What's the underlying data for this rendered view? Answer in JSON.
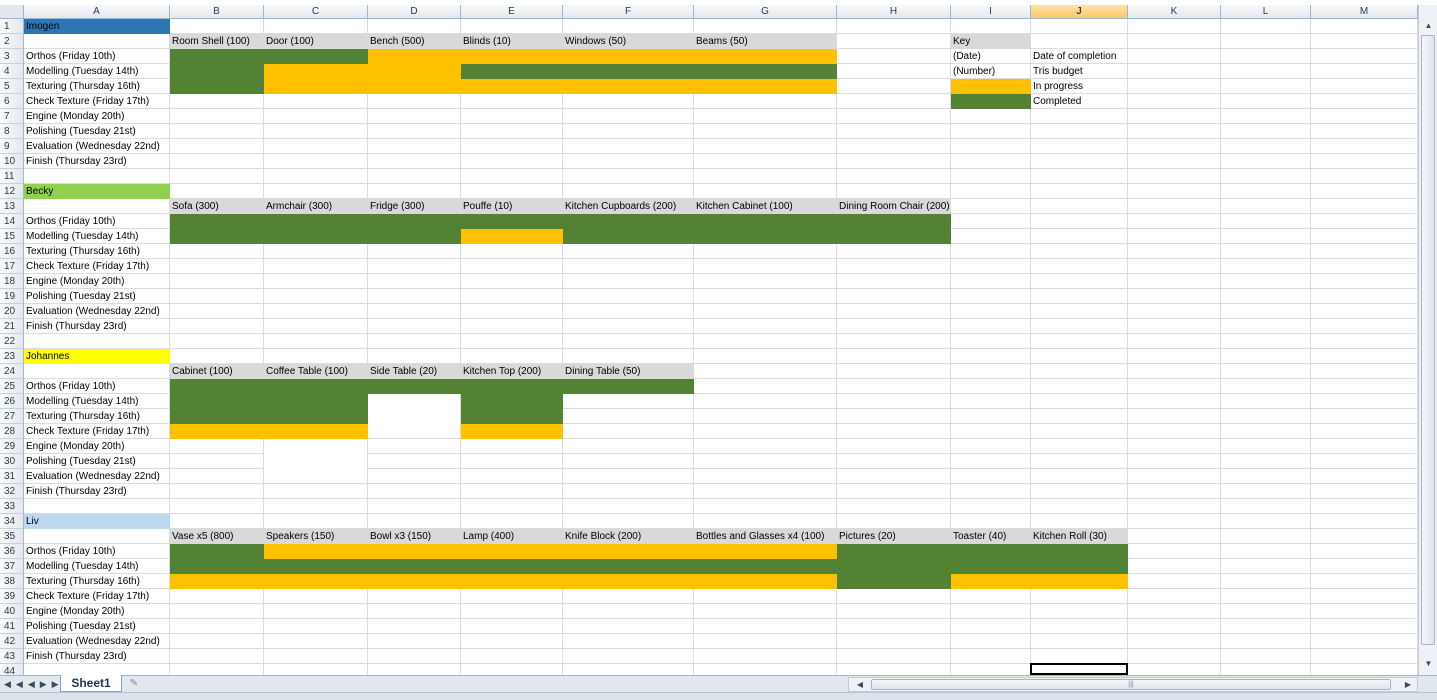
{
  "columns": [
    "A",
    "B",
    "C",
    "D",
    "E",
    "F",
    "G",
    "H",
    "I",
    "J",
    "K",
    "L",
    "M"
  ],
  "selected_column": "J",
  "colors": {
    "in_progress": "#ffc000",
    "completed": "#548235",
    "header_gray": "#d9d9d9",
    "imogen": "#2e75b6",
    "becky": "#92d050",
    "johannes": "#ffff00",
    "liv": "#bdd7ee"
  },
  "cells": [
    {
      "r": 1,
      "c": "A",
      "v": "Imogen",
      "fill": "#2e75b6"
    },
    {
      "r": 2,
      "c": "B",
      "v": "Room Shell (100)"
    },
    {
      "r": 2,
      "c": "C",
      "v": "Door (100)"
    },
    {
      "r": 2,
      "c": "D",
      "v": "Bench (500)"
    },
    {
      "r": 2,
      "c": "E",
      "v": "Blinds (10)"
    },
    {
      "r": 2,
      "c": "F",
      "v": "Windows (50)"
    },
    {
      "r": 2,
      "c": "G",
      "v": "Beams (50)"
    },
    {
      "r": 2,
      "c": "I",
      "v": "Key"
    },
    {
      "r": 3,
      "c": "A",
      "v": "Orthos (Friday 10th)"
    },
    {
      "r": 3,
      "c": "I",
      "v": "(Date)"
    },
    {
      "r": 3,
      "c": "J",
      "v": "Date of completion"
    },
    {
      "r": 4,
      "c": "A",
      "v": "Modelling (Tuesday 14th)"
    },
    {
      "r": 4,
      "c": "I",
      "v": "(Number)"
    },
    {
      "r": 4,
      "c": "J",
      "v": "Tris budget"
    },
    {
      "r": 5,
      "c": "A",
      "v": "Texturing (Thursday 16th)"
    },
    {
      "r": 5,
      "c": "J",
      "v": "In progress"
    },
    {
      "r": 6,
      "c": "A",
      "v": "Check Texture (Friday 17th)"
    },
    {
      "r": 6,
      "c": "J",
      "v": "Completed"
    },
    {
      "r": 7,
      "c": "A",
      "v": "Engine (Monday 20th)"
    },
    {
      "r": 8,
      "c": "A",
      "v": "Polishing (Tuesday 21st)"
    },
    {
      "r": 9,
      "c": "A",
      "v": "Evaluation (Wednesday 22nd)"
    },
    {
      "r": 10,
      "c": "A",
      "v": "Finish (Thursday 23rd)"
    },
    {
      "r": 12,
      "c": "A",
      "v": "Becky"
    },
    {
      "r": 13,
      "c": "B",
      "v": "Sofa (300)"
    },
    {
      "r": 13,
      "c": "C",
      "v": "Armchair (300)"
    },
    {
      "r": 13,
      "c": "D",
      "v": "Fridge (300)"
    },
    {
      "r": 13,
      "c": "E",
      "v": "Pouffe (10)"
    },
    {
      "r": 13,
      "c": "F",
      "v": "Kitchen Cupboards (200)"
    },
    {
      "r": 13,
      "c": "G",
      "v": "Kitchen Cabinet (100)"
    },
    {
      "r": 13,
      "c": "H",
      "v": "Dining Room Chair (200)"
    },
    {
      "r": 14,
      "c": "A",
      "v": "Orthos (Friday 10th)"
    },
    {
      "r": 15,
      "c": "A",
      "v": "Modelling (Tuesday 14th)"
    },
    {
      "r": 16,
      "c": "A",
      "v": "Texturing (Thursday 16th)"
    },
    {
      "r": 17,
      "c": "A",
      "v": "Check Texture (Friday 17th)"
    },
    {
      "r": 18,
      "c": "A",
      "v": "Engine (Monday 20th)"
    },
    {
      "r": 19,
      "c": "A",
      "v": "Polishing (Tuesday 21st)"
    },
    {
      "r": 20,
      "c": "A",
      "v": "Evaluation (Wednesday 22nd)"
    },
    {
      "r": 21,
      "c": "A",
      "v": "Finish (Thursday 23rd)"
    },
    {
      "r": 23,
      "c": "A",
      "v": "Johannes"
    },
    {
      "r": 24,
      "c": "B",
      "v": "Cabinet (100)"
    },
    {
      "r": 24,
      "c": "C",
      "v": "Coffee Table (100)"
    },
    {
      "r": 24,
      "c": "D",
      "v": "Side Table (20)"
    },
    {
      "r": 24,
      "c": "E",
      "v": "Kitchen Top (200)"
    },
    {
      "r": 24,
      "c": "F",
      "v": "Dining Table (50)"
    },
    {
      "r": 25,
      "c": "A",
      "v": "Orthos (Friday 10th)"
    },
    {
      "r": 26,
      "c": "A",
      "v": "Modelling (Tuesday 14th)"
    },
    {
      "r": 27,
      "c": "A",
      "v": "Texturing (Thursday 16th)"
    },
    {
      "r": 28,
      "c": "A",
      "v": "Check Texture (Friday 17th)"
    },
    {
      "r": 29,
      "c": "A",
      "v": "Engine (Monday 20th)"
    },
    {
      "r": 30,
      "c": "A",
      "v": "Polishing (Tuesday 21st)"
    },
    {
      "r": 31,
      "c": "A",
      "v": "Evaluation (Wednesday 22nd)"
    },
    {
      "r": 32,
      "c": "A",
      "v": "Finish (Thursday 23rd)"
    },
    {
      "r": 34,
      "c": "A",
      "v": "Liv"
    },
    {
      "r": 35,
      "c": "B",
      "v": "Vase x5  (800)"
    },
    {
      "r": 35,
      "c": "C",
      "v": "Speakers (150)"
    },
    {
      "r": 35,
      "c": "D",
      "v": "Bowl x3 (150)"
    },
    {
      "r": 35,
      "c": "E",
      "v": "Lamp (400)"
    },
    {
      "r": 35,
      "c": "F",
      "v": "Knife Block (200)"
    },
    {
      "r": 35,
      "c": "G",
      "v": "Bottles and Glasses x4 (100)"
    },
    {
      "r": 35,
      "c": "H",
      "v": "Pictures (20)"
    },
    {
      "r": 35,
      "c": "I",
      "v": "Toaster (40)"
    },
    {
      "r": 35,
      "c": "J",
      "v": "Kitchen Roll (30)"
    },
    {
      "r": 36,
      "c": "A",
      "v": "Orthos (Friday 10th)"
    },
    {
      "r": 37,
      "c": "A",
      "v": "Modelling (Tuesday 14th)"
    },
    {
      "r": 38,
      "c": "A",
      "v": "Texturing (Thursday 16th)"
    },
    {
      "r": 39,
      "c": "A",
      "v": "Check Texture (Friday 17th)"
    },
    {
      "r": 40,
      "c": "A",
      "v": "Engine (Monday 20th)"
    },
    {
      "r": 41,
      "c": "A",
      "v": "Polishing (Tuesday 21st)"
    },
    {
      "r": 42,
      "c": "A",
      "v": "Evaluation (Wednesday 22nd)"
    },
    {
      "r": 43,
      "c": "A",
      "v": "Finish (Thursday 23rd)"
    }
  ],
  "fills": [
    {
      "r": 2,
      "c1": "B",
      "c2": "G",
      "color": "#d9d9d9"
    },
    {
      "r": 2,
      "c1": "I",
      "c2": "I",
      "color": "#d9d9d9"
    },
    {
      "r": 3,
      "c1": "B",
      "c2": "C",
      "color": "#548235"
    },
    {
      "r": 3,
      "c1": "D",
      "c2": "G",
      "color": "#ffc000"
    },
    {
      "r": 4,
      "c1": "B",
      "c2": "B",
      "color": "#548235"
    },
    {
      "r": 4,
      "c1": "C",
      "c2": "D",
      "color": "#ffc000"
    },
    {
      "r": 4,
      "c1": "E",
      "c2": "G",
      "color": "#548235"
    },
    {
      "r": 5,
      "c1": "B",
      "c2": "B",
      "color": "#548235"
    },
    {
      "r": 5,
      "c1": "C",
      "c2": "G",
      "color": "#ffc000"
    },
    {
      "r": 5,
      "c1": "I",
      "c2": "I",
      "color": "#ffc000"
    },
    {
      "r": 6,
      "c1": "I",
      "c2": "I",
      "color": "#548235"
    },
    {
      "r": 12,
      "c1": "A",
      "c2": "A",
      "color": "#92d050"
    },
    {
      "r": 13,
      "c1": "B",
      "c2": "H",
      "color": "#d9d9d9"
    },
    {
      "r": 14,
      "c1": "B",
      "c2": "H",
      "color": "#548235"
    },
    {
      "r": 15,
      "c1": "B",
      "c2": "D",
      "color": "#548235"
    },
    {
      "r": 15,
      "c1": "E",
      "c2": "E",
      "color": "#ffc000"
    },
    {
      "r": 15,
      "c1": "F",
      "c2": "H",
      "color": "#548235"
    },
    {
      "r": 23,
      "c1": "A",
      "c2": "A",
      "color": "#ffff00"
    },
    {
      "r": 24,
      "c1": "B",
      "c2": "F",
      "color": "#d9d9d9"
    },
    {
      "r": 25,
      "c1": "B",
      "c2": "F",
      "color": "#548235"
    },
    {
      "r": 26,
      "c1": "B",
      "c2": "C",
      "color": "#548235"
    },
    {
      "r": 26,
      "c1": "E",
      "c2": "E",
      "color": "#548235"
    },
    {
      "r": 27,
      "c1": "B",
      "c2": "C",
      "color": "#548235"
    },
    {
      "r": 27,
      "c1": "E",
      "c2": "E",
      "color": "#548235"
    },
    {
      "r": 28,
      "c1": "B",
      "c2": "C",
      "color": "#ffc000"
    },
    {
      "r": 28,
      "c1": "E",
      "c2": "E",
      "color": "#ffc000"
    },
    {
      "r": 34,
      "c1": "A",
      "c2": "A",
      "color": "#bdd7ee"
    },
    {
      "r": 35,
      "c1": "B",
      "c2": "J",
      "color": "#d9d9d9"
    },
    {
      "r": 36,
      "c1": "B",
      "c2": "B",
      "color": "#548235"
    },
    {
      "r": 36,
      "c1": "C",
      "c2": "G",
      "color": "#ffc000"
    },
    {
      "r": 36,
      "c1": "H",
      "c2": "J",
      "color": "#548235"
    },
    {
      "r": 37,
      "c1": "B",
      "c2": "J",
      "color": "#548235"
    },
    {
      "r": 38,
      "c1": "B",
      "c2": "G",
      "color": "#ffc000"
    },
    {
      "r": 38,
      "c1": "H",
      "c2": "H",
      "color": "#548235"
    },
    {
      "r": 38,
      "c1": "I",
      "c2": "J",
      "color": "#ffc000"
    }
  ],
  "white_blocks": [
    {
      "r1": 26,
      "r2": 28,
      "c1": "D",
      "c2": "D"
    },
    {
      "r1": 29,
      "r2": 31,
      "c1": "C",
      "c2": "C"
    }
  ],
  "sheet_tab": "Sheet1",
  "selected_cell": {
    "r": 44,
    "c": "J"
  },
  "scroll_glyphs": {
    "up": "▲",
    "down": "▼",
    "left": "◀",
    "right": "▶",
    "grip": "|||"
  },
  "nav_glyphs": "◀◀◀▶▶▶"
}
